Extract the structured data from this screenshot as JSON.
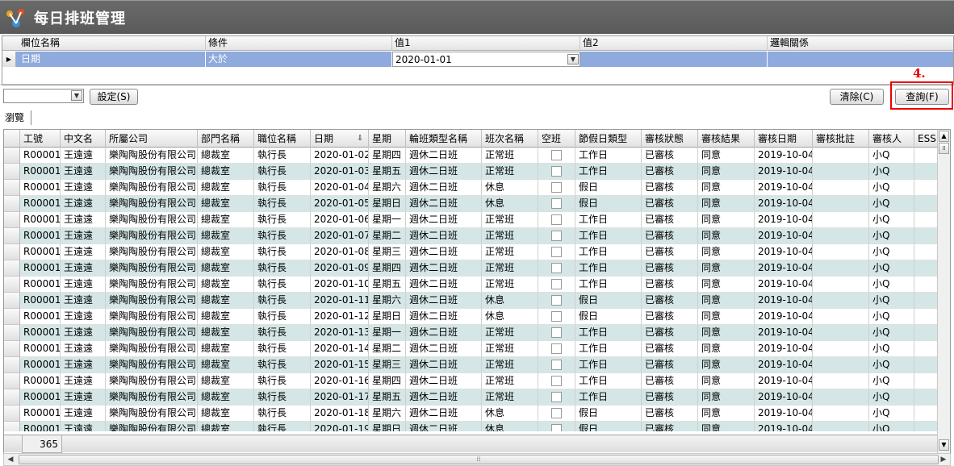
{
  "app": {
    "title": "每日排班管理"
  },
  "condition": {
    "headers": [
      "欄位名稱",
      "條件",
      "值1",
      "值2",
      "邏輯關係"
    ],
    "row": {
      "field": "日期",
      "op": "大於",
      "value1": "2020-01-01",
      "value2": "",
      "logic": ""
    }
  },
  "toolbar": {
    "combo_value": "",
    "set_label": "設定(S)",
    "clear_label": "清除(C)",
    "query_label": "查詢(F)",
    "step_label": "4."
  },
  "tab": {
    "label": "瀏覽"
  },
  "grid": {
    "columns": [
      "工號",
      "中文名",
      "所屬公司",
      "部門名稱",
      "職位名稱",
      "日期",
      "星期",
      "輪班類型名稱",
      "班次名稱",
      "空班",
      "節假日類型",
      "審核狀態",
      "審核結果",
      "審核日期",
      "審核批註",
      "審核人",
      "ESS"
    ],
    "sort_indicator": "⇩",
    "rows": [
      [
        "R00001",
        "王遠遠",
        "樂陶陶股份有限公司",
        "總裁室",
        "執行長",
        "2020-01-02",
        "星期四",
        "週休二日班",
        "正常班",
        "",
        "工作日",
        "已審核",
        "同意",
        "2019-10-04",
        "",
        "小Q",
        ""
      ],
      [
        "R00001",
        "王遠遠",
        "樂陶陶股份有限公司",
        "總裁室",
        "執行長",
        "2020-01-03",
        "星期五",
        "週休二日班",
        "正常班",
        "",
        "工作日",
        "已審核",
        "同意",
        "2019-10-04",
        "",
        "小Q",
        ""
      ],
      [
        "R00001",
        "王遠遠",
        "樂陶陶股份有限公司",
        "總裁室",
        "執行長",
        "2020-01-04",
        "星期六",
        "週休二日班",
        "休息",
        "",
        "假日",
        "已審核",
        "同意",
        "2019-10-04",
        "",
        "小Q",
        ""
      ],
      [
        "R00001",
        "王遠遠",
        "樂陶陶股份有限公司",
        "總裁室",
        "執行長",
        "2020-01-05",
        "星期日",
        "週休二日班",
        "休息",
        "",
        "假日",
        "已審核",
        "同意",
        "2019-10-04",
        "",
        "小Q",
        ""
      ],
      [
        "R00001",
        "王遠遠",
        "樂陶陶股份有限公司",
        "總裁室",
        "執行長",
        "2020-01-06",
        "星期一",
        "週休二日班",
        "正常班",
        "",
        "工作日",
        "已審核",
        "同意",
        "2019-10-04",
        "",
        "小Q",
        ""
      ],
      [
        "R00001",
        "王遠遠",
        "樂陶陶股份有限公司",
        "總裁室",
        "執行長",
        "2020-01-07",
        "星期二",
        "週休二日班",
        "正常班",
        "",
        "工作日",
        "已審核",
        "同意",
        "2019-10-04",
        "",
        "小Q",
        ""
      ],
      [
        "R00001",
        "王遠遠",
        "樂陶陶股份有限公司",
        "總裁室",
        "執行長",
        "2020-01-08",
        "星期三",
        "週休二日班",
        "正常班",
        "",
        "工作日",
        "已審核",
        "同意",
        "2019-10-04",
        "",
        "小Q",
        ""
      ],
      [
        "R00001",
        "王遠遠",
        "樂陶陶股份有限公司",
        "總裁室",
        "執行長",
        "2020-01-09",
        "星期四",
        "週休二日班",
        "正常班",
        "",
        "工作日",
        "已審核",
        "同意",
        "2019-10-04",
        "",
        "小Q",
        ""
      ],
      [
        "R00001",
        "王遠遠",
        "樂陶陶股份有限公司",
        "總裁室",
        "執行長",
        "2020-01-10",
        "星期五",
        "週休二日班",
        "正常班",
        "",
        "工作日",
        "已審核",
        "同意",
        "2019-10-04",
        "",
        "小Q",
        ""
      ],
      [
        "R00001",
        "王遠遠",
        "樂陶陶股份有限公司",
        "總裁室",
        "執行長",
        "2020-01-11",
        "星期六",
        "週休二日班",
        "休息",
        "",
        "假日",
        "已審核",
        "同意",
        "2019-10-04",
        "",
        "小Q",
        ""
      ],
      [
        "R00001",
        "王遠遠",
        "樂陶陶股份有限公司",
        "總裁室",
        "執行長",
        "2020-01-12",
        "星期日",
        "週休二日班",
        "休息",
        "",
        "假日",
        "已審核",
        "同意",
        "2019-10-04",
        "",
        "小Q",
        ""
      ],
      [
        "R00001",
        "王遠遠",
        "樂陶陶股份有限公司",
        "總裁室",
        "執行長",
        "2020-01-13",
        "星期一",
        "週休二日班",
        "正常班",
        "",
        "工作日",
        "已審核",
        "同意",
        "2019-10-04",
        "",
        "小Q",
        ""
      ],
      [
        "R00001",
        "王遠遠",
        "樂陶陶股份有限公司",
        "總裁室",
        "執行長",
        "2020-01-14",
        "星期二",
        "週休二日班",
        "正常班",
        "",
        "工作日",
        "已審核",
        "同意",
        "2019-10-04",
        "",
        "小Q",
        ""
      ],
      [
        "R00001",
        "王遠遠",
        "樂陶陶股份有限公司",
        "總裁室",
        "執行長",
        "2020-01-15",
        "星期三",
        "週休二日班",
        "正常班",
        "",
        "工作日",
        "已審核",
        "同意",
        "2019-10-04",
        "",
        "小Q",
        ""
      ],
      [
        "R00001",
        "王遠遠",
        "樂陶陶股份有限公司",
        "總裁室",
        "執行長",
        "2020-01-16",
        "星期四",
        "週休二日班",
        "正常班",
        "",
        "工作日",
        "已審核",
        "同意",
        "2019-10-04",
        "",
        "小Q",
        ""
      ],
      [
        "R00001",
        "王遠遠",
        "樂陶陶股份有限公司",
        "總裁室",
        "執行長",
        "2020-01-17",
        "星期五",
        "週休二日班",
        "正常班",
        "",
        "工作日",
        "已審核",
        "同意",
        "2019-10-04",
        "",
        "小Q",
        ""
      ],
      [
        "R00001",
        "王遠遠",
        "樂陶陶股份有限公司",
        "總裁室",
        "執行長",
        "2020-01-18",
        "星期六",
        "週休二日班",
        "休息",
        "",
        "假日",
        "已審核",
        "同意",
        "2019-10-04",
        "",
        "小Q",
        ""
      ],
      [
        "R00001",
        "王遠遠",
        "樂陶陶股份有限公司",
        "總裁室",
        "執行長",
        "2020-01-19",
        "星期日",
        "週休二日班",
        "休息",
        "",
        "假日",
        "已審核",
        "同意",
        "2019-10-04",
        "",
        "小Q",
        ""
      ]
    ],
    "record_count": "365"
  },
  "colors": {
    "title_bg": "#5f5f5f",
    "selected_row": "#8faadc",
    "alt_row": "#d4e6e6",
    "highlight": "#ee0000"
  }
}
